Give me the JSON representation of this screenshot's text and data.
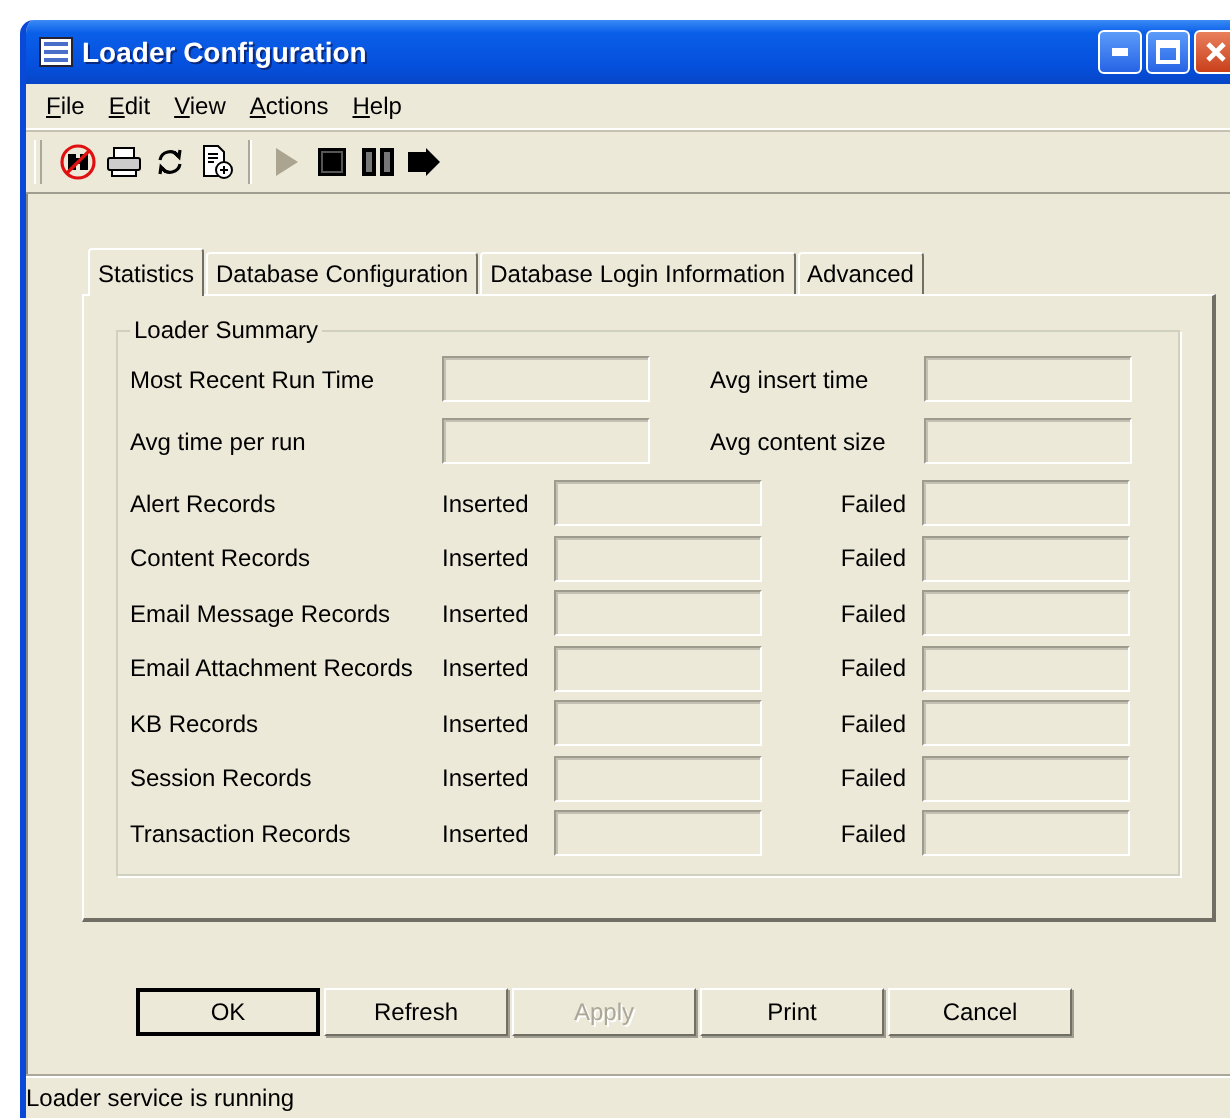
{
  "window": {
    "title": "Loader Configuration"
  },
  "menu": [
    {
      "label": "File"
    },
    {
      "label": "Edit"
    },
    {
      "label": "View"
    },
    {
      "label": "Actions"
    },
    {
      "label": "Help"
    }
  ],
  "toolbar": [
    {
      "kind": "binoculars-blocked",
      "disabled": false
    },
    {
      "kind": "printer",
      "disabled": false
    },
    {
      "kind": "refresh",
      "disabled": false
    },
    {
      "kind": "document-add",
      "disabled": false
    },
    {
      "kind": "separator"
    },
    {
      "kind": "play",
      "disabled": true
    },
    {
      "kind": "stop",
      "disabled": false
    },
    {
      "kind": "pause",
      "disabled": false
    },
    {
      "kind": "step",
      "disabled": false
    }
  ],
  "tabs": [
    {
      "label": "Statistics",
      "selected": true
    },
    {
      "label": "Database Configuration",
      "selected": false
    },
    {
      "label": "Database Login Information",
      "selected": false
    },
    {
      "label": "Advanced",
      "selected": false
    }
  ],
  "loader_summary": {
    "title": "Loader Summary",
    "summary_rows": [
      {
        "label": "Most Recent Run Time",
        "right_label": "Avg insert time"
      },
      {
        "label": "Avg time per run",
        "right_label": "Avg content size"
      }
    ],
    "record_rows": [
      {
        "label": "Alert Records",
        "inserted_label": "Inserted",
        "failed_label": "Failed"
      },
      {
        "label": "Content Records",
        "inserted_label": "Inserted",
        "failed_label": "Failed"
      },
      {
        "label": "Email Message Records",
        "inserted_label": "Inserted",
        "failed_label": "Failed"
      },
      {
        "label": "Email Attachment Records",
        "inserted_label": "Inserted",
        "failed_label": "Failed"
      },
      {
        "label": "KB Records",
        "inserted_label": "Inserted",
        "failed_label": "Failed"
      },
      {
        "label": "Session Records",
        "inserted_label": "Inserted",
        "failed_label": "Failed"
      },
      {
        "label": "Transaction Records",
        "inserted_label": "Inserted",
        "failed_label": "Failed"
      }
    ]
  },
  "buttons": [
    {
      "label": "OK",
      "default": true,
      "disabled": false
    },
    {
      "label": "Refresh",
      "default": false,
      "disabled": false
    },
    {
      "label": "Apply",
      "default": false,
      "disabled": true
    },
    {
      "label": "Print",
      "default": false,
      "disabled": false
    },
    {
      "label": "Cancel",
      "default": false,
      "disabled": false
    }
  ],
  "status_bar": {
    "text": "Loader service is running"
  }
}
